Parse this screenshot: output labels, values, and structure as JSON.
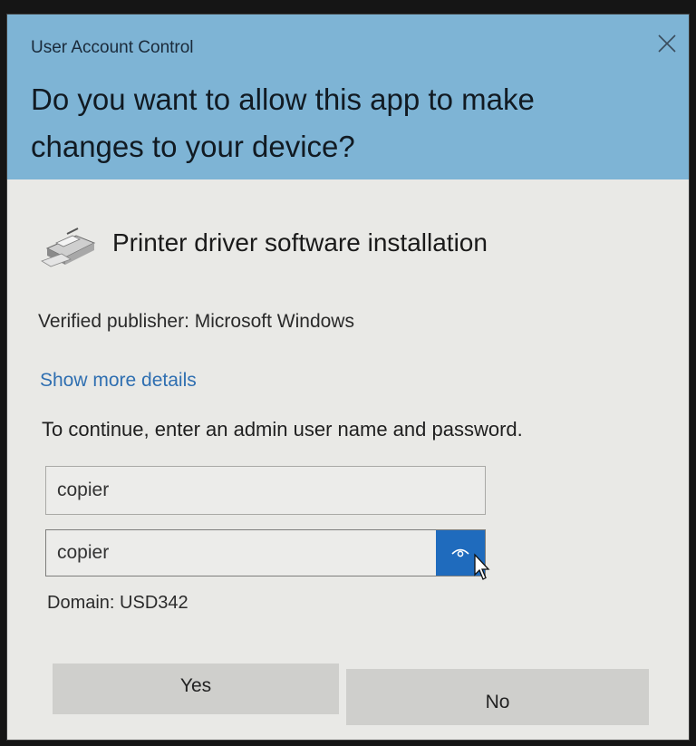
{
  "window": {
    "caption": "User Account Control"
  },
  "header": {
    "question": "Do you want to allow this app to make changes to your device?"
  },
  "app": {
    "name": "Printer driver software installation",
    "icon": "printer-icon"
  },
  "publisher": "Verified publisher: Microsoft Windows",
  "details_link": "Show more details",
  "instructions": "To continue, enter an admin user name and password.",
  "form": {
    "username_value": "copier",
    "password_value": "copier",
    "reveal_icon": "eye-icon"
  },
  "domain": "Domain: USD342",
  "buttons": {
    "yes": "Yes",
    "no": "No"
  },
  "colors": {
    "header_bg": "#7eb4d5",
    "body_bg": "#e9e9e6",
    "link": "#2f6fb1",
    "reveal_button": "#1f6bbd",
    "button_bg": "#cfcfcc"
  }
}
